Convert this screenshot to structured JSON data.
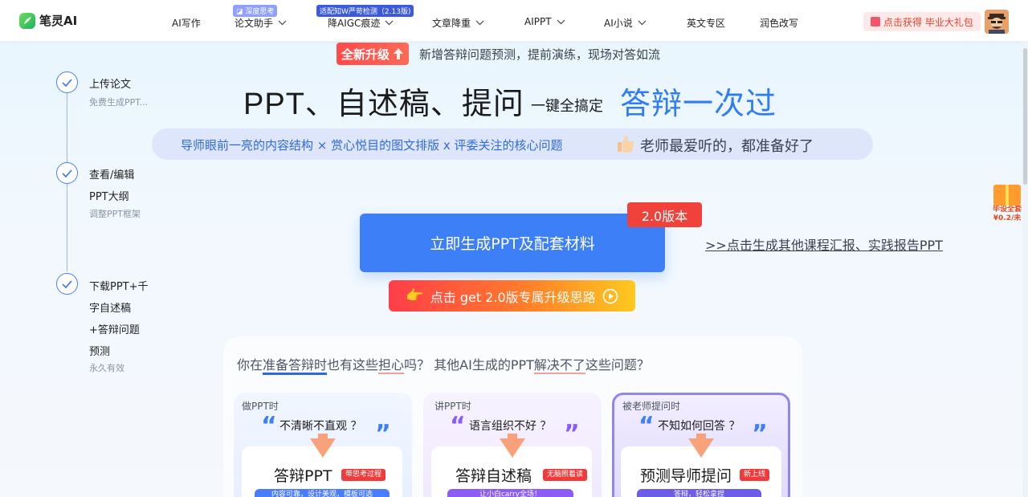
{
  "header": {
    "logo_text": "笔灵AI",
    "nav": [
      {
        "label": "AI写作"
      },
      {
        "label": "论文助手",
        "badge": "深度思考"
      },
      {
        "label": "降AIGC痕迹",
        "badge": "适配知W严苛检测（2.13版)"
      },
      {
        "label": "文章降重"
      },
      {
        "label": "AIPPT"
      },
      {
        "label": "AI小说"
      },
      {
        "label": "英文专区"
      },
      {
        "label": "润色改写"
      }
    ],
    "gift_button": "点击获得 毕业大礼包"
  },
  "float_gift": {
    "line1": "毕设全套",
    "line2": "¥0.2/未"
  },
  "steps": [
    {
      "title": "上传论文",
      "sub": "免费生成PPT..."
    },
    {
      "title": "查看/编辑",
      "title2": "PPT大纲",
      "sub": "调整PPT框架"
    },
    {
      "title": "下载PPT+千",
      "title2": "字自述稿",
      "title3": "+答辩问题",
      "title4": "预测",
      "sub": "永久有效"
    }
  ],
  "hero": {
    "upgrade_tag": "全新升级",
    "upgrade_text": "新增答辩问题预测，提前演练，现场对答如流",
    "title": "PPT、自述稿、提问",
    "title_mid": "一键全搞定",
    "title_accent": "答辩一次过",
    "pill_left": "导师眼前一亮的内容结构 × 赏心悦目的图文排版 x 评委关注的核心问题",
    "pill_right": "老师最爱听的，都准备好了"
  },
  "cta": {
    "main": "立即生成PPT及配套材料",
    "version": "2.0版本",
    "side_link": ">>点击生成其他课程汇报、实践报告PPT",
    "sub": "点击 get 2.0版专属升级思路"
  },
  "panel": {
    "q_pre": "你在",
    "q_blue": "准备答辩时",
    "q_mid1": "也有这些",
    "q_red1": "担心",
    "q_mid2": "吗？ 其他AI生成的PPT",
    "q_red2": "解决不了",
    "q_post": "这些问题？",
    "cards": [
      {
        "head": "做PPT时",
        "quote": "不清晰不直观 ？",
        "title": "答辩PPT",
        "tag": "带思考过程",
        "bar": "内容可靠，设计美观，模板可选"
      },
      {
        "head": "讲PPT时",
        "quote": "语言组织不好 ？",
        "title": "答辩自述稿",
        "tag": "无脑照着读",
        "bar": "让小白carry全场！"
      },
      {
        "head": "被老师提问时",
        "quote": "不知如何回答 ？",
        "title": "预测导师提问",
        "tag": "新上线",
        "bar": "答辩，轻松拿捏"
      }
    ]
  },
  "colors": {
    "primary": "#3c7ff7",
    "accent_red": "#f0413b",
    "title_blue": "#2f7cf6"
  }
}
